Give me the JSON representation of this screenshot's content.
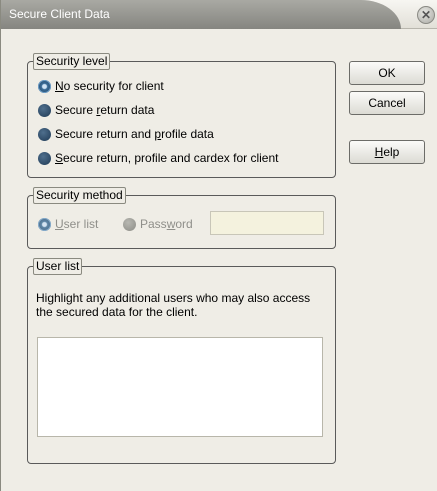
{
  "window": {
    "title": "Secure Client Data"
  },
  "security_level": {
    "legend": "Security level",
    "options": [
      {
        "pre": "",
        "key": "N",
        "post": "o security for client",
        "checked": true
      },
      {
        "pre": "Secure ",
        "key": "r",
        "post": "eturn data",
        "checked": false
      },
      {
        "pre": "Secure return and ",
        "key": "p",
        "post": "rofile data",
        "checked": false
      },
      {
        "pre": "",
        "key": "S",
        "post": "ecure return, profile and cardex for client",
        "checked": false
      }
    ]
  },
  "security_method": {
    "legend": "Security method",
    "user_list": {
      "pre": "",
      "key": "U",
      "post": "ser list"
    },
    "password": {
      "pre": "Pass",
      "key": "w",
      "post": "ord"
    },
    "password_value": ""
  },
  "user_list": {
    "legend": "User list",
    "instructions": "Highlight any additional users who may also access the secured data for the client."
  },
  "buttons": {
    "ok": "OK",
    "cancel": "Cancel",
    "help_key": "H",
    "help_rest": "elp"
  }
}
